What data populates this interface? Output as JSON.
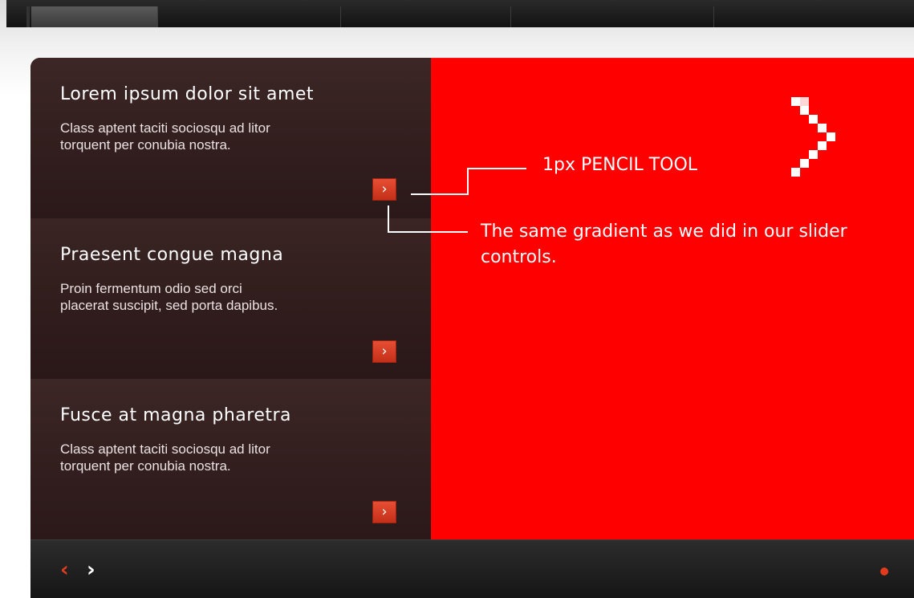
{
  "panels": [
    {
      "title": "Lorem ipsum dolor sit amet",
      "desc_line1": "Class aptent taciti sociosqu ad litor",
      "desc_line2": "torquent per conubia nostra.",
      "more_glyph": "›"
    },
    {
      "title": "Praesent congue magna",
      "desc_line1": "Proin fermentum odio sed orci",
      "desc_line2": "placerat suscipit, sed porta dapibus.",
      "more_glyph": "›"
    },
    {
      "title": "Fusce at magna pharetra",
      "desc_line1": "Class aptent taciti sociosqu ad litor",
      "desc_line2": "torquent per conubia nostra.",
      "more_glyph": "›"
    }
  ],
  "annotations": {
    "pencil_tool": "1px PENCIL TOOL",
    "gradient_note": "The same gradient as we did in our slider controls."
  },
  "footer": {
    "prev_glyph": "‹",
    "next_glyph": "›"
  },
  "colors": {
    "accent": "#e23b1e",
    "slide_bg": "#ff0000",
    "panel_bg": "#2f1c1c"
  },
  "icons": {
    "prev": "chevron-left-icon",
    "next": "chevron-right-icon",
    "big_arrow": "pixel-chevron-right-icon",
    "pager": "dot-icon"
  }
}
